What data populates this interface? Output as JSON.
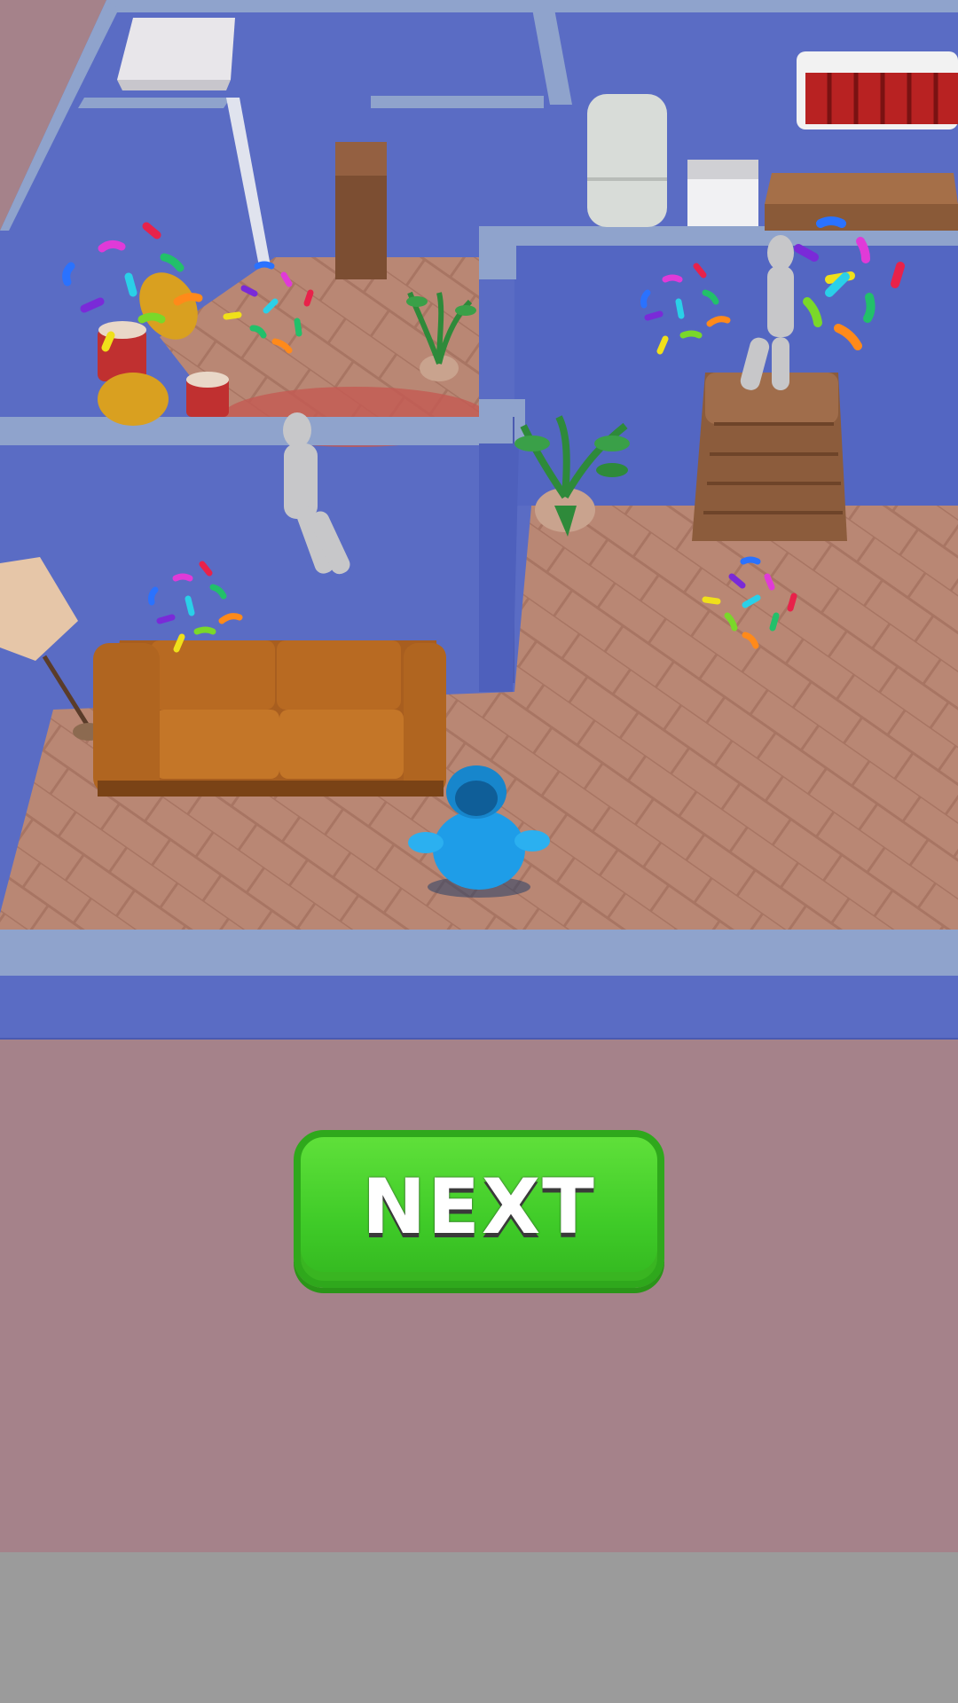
{
  "next_button": {
    "label": "NEXT"
  },
  "colors": {
    "wall": "#5a6cc4",
    "wall_top": "#8fa3cc",
    "floor": "#b98774",
    "background": "#a5828a",
    "bottom_bar": "#9b9b9b",
    "button_green": "#44cc2c",
    "player": "#2a9fe0",
    "sofa": "#b86a22"
  },
  "scene": {
    "player": "blue-hooded-character",
    "silhouettes": [
      "sitting-figure",
      "standing-figure",
      "figure-on-dresser"
    ],
    "furniture": [
      "bench",
      "wardrobe",
      "refrigerator",
      "stove",
      "kitchen-counter",
      "kitchen-cabinets",
      "drum-kit",
      "dresser",
      "sofa",
      "floor-lamp",
      "potted-plant",
      "potted-plant",
      "rug"
    ],
    "effects": [
      "confetti-burst",
      "confetti-burst",
      "confetti-burst",
      "confetti-burst",
      "confetti-burst",
      "confetti-burst"
    ]
  }
}
